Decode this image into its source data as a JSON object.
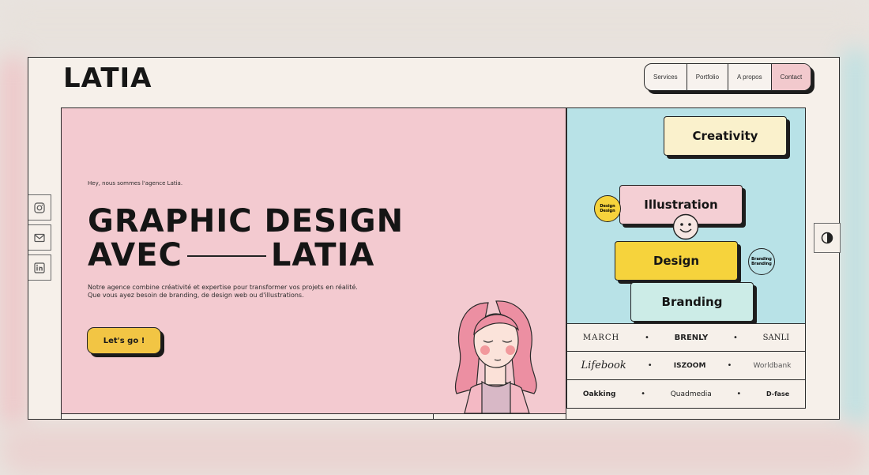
{
  "brand": {
    "logo_text": "LATIA"
  },
  "nav": {
    "items": [
      {
        "label": "Services"
      },
      {
        "label": "Portfolio"
      },
      {
        "label": "A propos"
      },
      {
        "label": "Contact"
      }
    ]
  },
  "socials": [
    {
      "icon": "instagram-icon"
    },
    {
      "icon": "mail-icon"
    },
    {
      "icon": "linkedin-icon"
    }
  ],
  "hero": {
    "tagline": "Hey, nous sommes l'agence Latia.",
    "title_line1": "GRAPHIC DESIGN",
    "title_line2_left": "AVEC",
    "title_line2_right": "LATIA",
    "description": "Notre agence combine créativité et expertise pour transformer vos projets en réalité. Que vous ayez besoin de branding, de design web ou d'illustrations.",
    "cta_label": "Let's go !"
  },
  "pills": [
    {
      "label": "Creativity",
      "color": "#faf1cc"
    },
    {
      "label": "Illustration",
      "color": "#f4cfd4"
    },
    {
      "label": "Design",
      "color": "#f6d33c"
    },
    {
      "label": "Branding",
      "color": "#ccece7"
    }
  ],
  "badges": [
    {
      "text": "Design Design",
      "color": "#f6d33c"
    },
    {
      "text": "Branding Branding",
      "color": "#b8e2e7"
    }
  ],
  "brands": {
    "row1": [
      "MARCH",
      "BRENLY",
      "SANLI"
    ],
    "row2": [
      "Lifebook",
      "ISZOOM",
      "Worldbank"
    ],
    "row3": [
      "Oakking",
      "Quadmedia",
      "D-fase"
    ]
  },
  "colors": {
    "accent_yellow": "#f2c544",
    "hero_pink": "#f3cad0",
    "panel_blue": "#b8e2e7"
  }
}
